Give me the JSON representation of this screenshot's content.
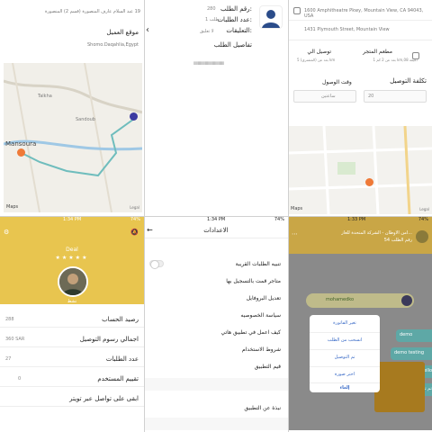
{
  "panel1": {
    "address": "19 عبد السلام عارف المنصورة (قسم 2) المنصورة",
    "location_title": "موقع العميل",
    "location_value": "Shomo.Daqahlia,Egypt",
    "map_labels": [
      "Talkha",
      "Sandoub",
      "Mansoura"
    ],
    "maps_brand": "Maps",
    "legal": "Legal"
  },
  "panel2": {
    "order_number_label": "رقم الطلب:",
    "order_number_value": "280",
    "request_count_label": "عدد الطلبات:",
    "request_count_value": "1 طلب",
    "comments_label": "التعليقات:",
    "comments_value": "لا تعليق",
    "details_title": "تفاصيل الطلب",
    "details_hash": "iiiiiiiiiiiiiiiiiiiiiiiiiiiiiiiiiiiiii"
  },
  "panel3": {
    "address1": "1600 Amphitheatre Pkwy, Mountain View, CA 94043, USA",
    "address2": "1431 Plymouth Street, Mountain View",
    "store_card_title": "مطعم المتجر",
    "store_card_sub": "بعد عن 2 كم 1 km,08 دقيقة",
    "delivery_card_title": "توصيل الي",
    "delivery_card_sub": "بعد عن (المشتري) 5 km",
    "cost_title": "تكلفة التوصيل",
    "cost_value": "20",
    "arrival_time_title": "وقت الوصول",
    "access_title": "الوصول",
    "time_value": "ساعتين",
    "maps_brand": "Maps",
    "legal": "Legal"
  },
  "panel4": {
    "time": "1:34 PM",
    "battery": "74%",
    "name": "Deal",
    "stars": "★★★★★",
    "online_label": "نشط",
    "rows": [
      {
        "key": "رصيد الحساب",
        "value": "288"
      },
      {
        "key": "اجمالي رسوم التوصيل",
        "value": "360 SAR"
      },
      {
        "key": "عدد الطلبات",
        "value": "27"
      },
      {
        "key": "تقييم المستخدم",
        "value": "0"
      },
      {
        "key": "ابقى على تواصل عبر تويتر",
        "value": ""
      }
    ]
  },
  "panel5": {
    "time": "1:34 PM",
    "battery": "74%",
    "title": "الاعدادات",
    "items": [
      "تنبيه الطلبات القريبة",
      "متاجر قمت بالتسجيل بها",
      "تعديل البروفايل",
      "سياسة الخصوصيه",
      "كيف اعمل في تطبيق هاتي",
      "شروط الاستخدام",
      "قيم التطبيق",
      "نبذة عن التطبيق"
    ]
  },
  "panel6": {
    "time": "1:33 PM",
    "battery": "74%",
    "header_line1": "امن الاوطان - الشركة المتحدة للغاز...",
    "header_line2": "رقم الطلب 54",
    "msg_text": "mohamedko",
    "teal1": "demo",
    "teal2": "demo testing",
    "teal3": "hello",
    "teal4": "تم تغيير الا",
    "sheet_options": [
      "تغير الفاتورة",
      "انسحب من الطلب",
      "تم التوصيل",
      "اختر صورة",
      "إلغاء"
    ]
  }
}
